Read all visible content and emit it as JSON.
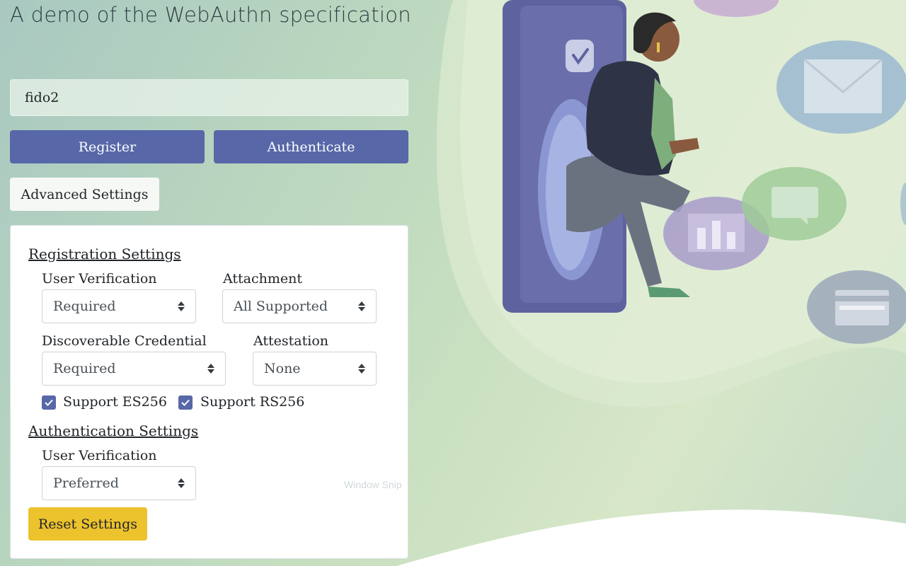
{
  "page": {
    "title": "A demo of the WebAuthn specification"
  },
  "username": {
    "value": "fido2"
  },
  "actions": {
    "register_label": "Register",
    "authenticate_label": "Authenticate",
    "advanced_label": "Advanced Settings"
  },
  "registration": {
    "title": "Registration Settings",
    "user_verification": {
      "label": "User Verification",
      "value": "Required"
    },
    "attachment": {
      "label": "Attachment",
      "value": "All Supported"
    },
    "discoverable": {
      "label": "Discoverable Credential",
      "value": "Required"
    },
    "attestation": {
      "label": "Attestation",
      "value": "None"
    },
    "es256": {
      "label": "Support ES256",
      "checked": true
    },
    "rs256": {
      "label": "Support RS256",
      "checked": true
    }
  },
  "authentication": {
    "title": "Authentication Settings",
    "user_verification": {
      "label": "User Verification",
      "value": "Preferred"
    }
  },
  "reset_label": "Reset Settings",
  "ghost_text": "Window Snip",
  "colors": {
    "primary": "#5767a8",
    "reset": "#ecc22d",
    "phone": "#5e63a0"
  },
  "icons": {
    "checkbox": "check-icon",
    "select": "sort-arrows-icon",
    "illustration_bubbles": [
      "envelope-icon",
      "bar-chart-icon",
      "chat-icon",
      "credit-card-icon"
    ]
  }
}
